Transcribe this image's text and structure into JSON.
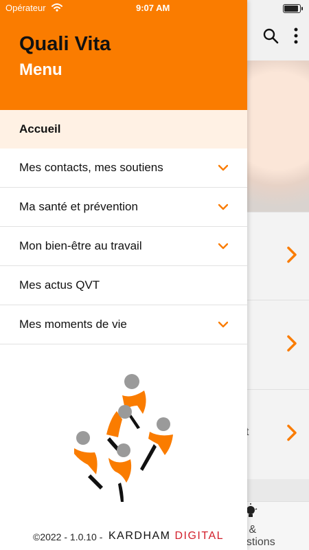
{
  "status_bar": {
    "carrier": "Opérateur",
    "time": "9:07 AM"
  },
  "drawer": {
    "app_title": "Quali Vita",
    "menu_title": "Menu",
    "items": [
      {
        "label": "Accueil",
        "active": true,
        "expandable": false
      },
      {
        "label": "Mes contacts, mes soutiens",
        "active": false,
        "expandable": true
      },
      {
        "label": "Ma santé et prévention",
        "active": false,
        "expandable": true
      },
      {
        "label": "Mon bien-être au travail",
        "active": false,
        "expandable": true
      },
      {
        "label": "Mes actus QVT",
        "active": false,
        "expandable": false
      },
      {
        "label": "Mes moments de vie",
        "active": false,
        "expandable": true
      }
    ],
    "footer": {
      "copyright": "©2022 - 1.0.10 -",
      "brand_kardham": "KARDHAM",
      "brand_digital": "DIGITAL"
    }
  },
  "background": {
    "partial_text_1": "t",
    "tabbar_partial_1": "s &",
    "tabbar_partial_2": "estions"
  },
  "colors": {
    "accent": "#fa7c00",
    "active_bg": "#fff1e4",
    "brand_red": "#d21f2b"
  }
}
